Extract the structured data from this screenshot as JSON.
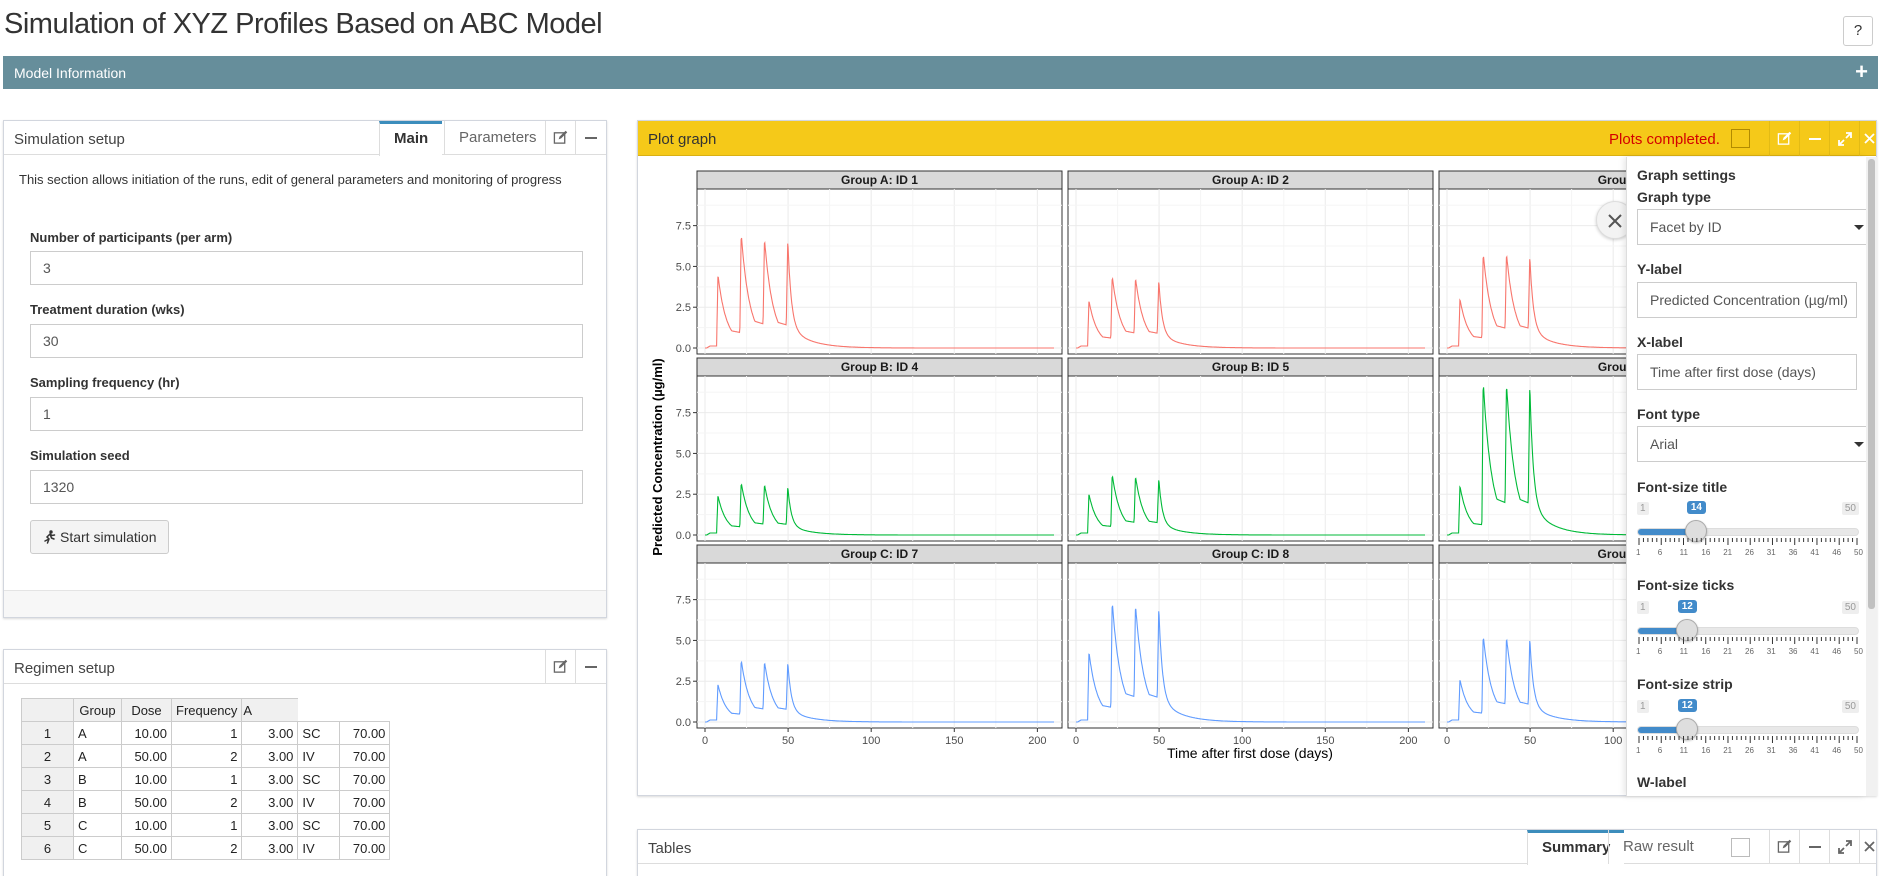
{
  "app": {
    "title": "Simulation of XYZ Profiles Based on ABC Model",
    "help_label": "?"
  },
  "model_info": {
    "label": "Model Information",
    "expand": "+"
  },
  "simulation_setup": {
    "title": "Simulation setup",
    "tabs": [
      "Main",
      "Parameters"
    ],
    "active_tab": "Main",
    "description": "This section allows initiation of the runs, edit of general parameters and monitoring of progress",
    "fields": [
      {
        "label": "Number of participants (per arm)",
        "value": "3"
      },
      {
        "label": "Treatment duration (wks)",
        "value": "30"
      },
      {
        "label": "Sampling frequency (hr)",
        "value": "1"
      },
      {
        "label": "Simulation seed",
        "value": "1320"
      }
    ],
    "start_button": "Start simulation"
  },
  "regimen_setup": {
    "title": "Regimen setup",
    "columns": [
      "",
      "Group",
      "Dose",
      "Frequency",
      "A"
    ],
    "rows": [
      [
        "1",
        "A",
        "10.00",
        "1",
        "3.00",
        "SC",
        "70.00"
      ],
      [
        "2",
        "A",
        "50.00",
        "2",
        "3.00",
        "IV",
        "70.00"
      ],
      [
        "3",
        "B",
        "10.00",
        "1",
        "3.00",
        "SC",
        "70.00"
      ],
      [
        "4",
        "B",
        "50.00",
        "2",
        "3.00",
        "IV",
        "70.00"
      ],
      [
        "5",
        "C",
        "10.00",
        "1",
        "3.00",
        "SC",
        "70.00"
      ],
      [
        "6",
        "C",
        "50.00",
        "2",
        "3.00",
        "IV",
        "70.00"
      ]
    ]
  },
  "plot_graph": {
    "title": "Plot graph",
    "status": "Plots completed.",
    "header_color": "#f5c919",
    "status_color": "#d40000"
  },
  "graph_settings": {
    "title": "Graph settings",
    "graph_type_label": "Graph type",
    "graph_type_value": "Facet by ID",
    "ylabel_label": "Y-label",
    "ylabel_value": "Predicted Concentration (µg/ml)",
    "xlabel_label": "X-label",
    "xlabel_value": "Time after first dose (days)",
    "font_type_label": "Font type",
    "font_type_value": "Arial",
    "sliders": [
      {
        "label": "Font-size title",
        "min": "1",
        "max": "50",
        "value": "14",
        "fraction": 0.265
      },
      {
        "label": "Font-size ticks",
        "min": "1",
        "max": "50",
        "value": "12",
        "fraction": 0.224
      },
      {
        "label": "Font-size strip",
        "min": "1",
        "max": "50",
        "value": "12",
        "fraction": 0.224
      }
    ],
    "tick_labels": [
      "1",
      "6",
      "11",
      "16",
      "21",
      "26",
      "31",
      "36",
      "41",
      "46",
      "50"
    ],
    "next_label": "W-label"
  },
  "tables": {
    "title": "Tables",
    "tabs": [
      "Summary",
      "Raw result"
    ],
    "active_tab": "Summary"
  },
  "chart_data": {
    "type": "line",
    "facet_rows": 3,
    "facet_cols": 3,
    "xlabel": "Time after first dose (days)",
    "ylabel": "Predicted Concentration (µg/ml)",
    "xlim": [
      0,
      210
    ],
    "ylim": [
      0,
      9.5
    ],
    "x_ticks": [
      "0",
      "50",
      "100",
      "150",
      "200"
    ],
    "y_ticks": [
      "0.0",
      "2.5",
      "5.0",
      "7.5"
    ],
    "dose_days": [
      7,
      21,
      35,
      49
    ],
    "panels": [
      {
        "title": "Group A: ID 1",
        "group": "A",
        "color": "#f8766d",
        "peaks": [
          4.5,
          7.0,
          6.7,
          6.7
        ]
      },
      {
        "title": "Group A: ID 2",
        "group": "A",
        "color": "#f8766d",
        "peaks": [
          2.9,
          4.4,
          4.3,
          4.2
        ]
      },
      {
        "title": "Group A",
        "group": "A",
        "color": "#f8766d",
        "peaks": [
          3.0,
          5.8,
          5.8,
          5.7
        ]
      },
      {
        "title": "Group B: ID 4",
        "group": "B",
        "color": "#00ba38",
        "peaks": [
          2.4,
          3.2,
          3.1,
          3.0
        ]
      },
      {
        "title": "Group B: ID 5",
        "group": "B",
        "color": "#00ba38",
        "peaks": [
          2.5,
          3.7,
          3.6,
          3.5
        ]
      },
      {
        "title": "Group E",
        "group": "B",
        "color": "#00ba38",
        "peaks": [
          3.0,
          9.4,
          9.3,
          9.3
        ]
      },
      {
        "title": "Group C: ID 7",
        "group": "C",
        "color": "#619cff",
        "peaks": [
          2.3,
          3.8,
          3.7,
          3.7
        ]
      },
      {
        "title": "Group C: ID 8",
        "group": "C",
        "color": "#619cff",
        "peaks": [
          4.3,
          7.4,
          7.2,
          7.1
        ]
      },
      {
        "title": "Group C",
        "group": "C",
        "color": "#619cff",
        "peaks": [
          2.6,
          5.3,
          5.2,
          5.2
        ]
      }
    ]
  }
}
